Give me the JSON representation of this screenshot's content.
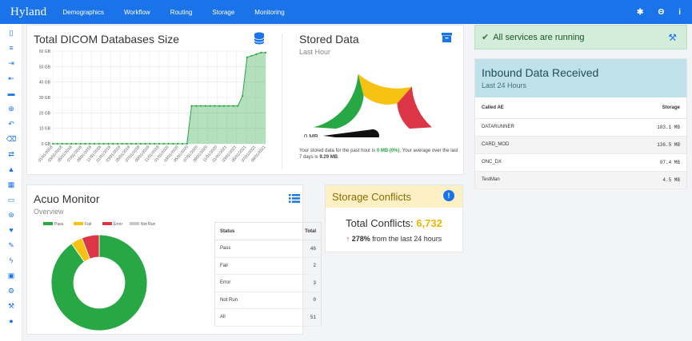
{
  "nav": {
    "brand": "Hyland",
    "links": [
      "Demographics",
      "Workflow",
      "Routing",
      "Storage",
      "Monitoring"
    ],
    "right_icons": [
      "gear-icon",
      "user-circle-icon",
      "info-icon"
    ],
    "right_glyphs": [
      "✱",
      "Θ",
      "i"
    ]
  },
  "sidebar": {
    "icons": [
      "file-icon",
      "database-icon",
      "sign-in-icon",
      "sign-out-icon",
      "archive-icon",
      "globe-icon",
      "undo-icon",
      "trash-icon",
      "exchange-icon",
      "road-icon",
      "map-icon",
      "hdd-icon",
      "life-ring-icon",
      "heartbeat-icon",
      "edit-icon",
      "bolt-icon",
      "lock-icon",
      "cogs-icon",
      "wrench-icon",
      "info-circle-icon"
    ],
    "glyphs": [
      "▯",
      "≡",
      "⇥",
      "⇤",
      "▬",
      "⊕",
      "↶",
      "⌫",
      "⇄",
      "▲",
      "▦",
      "▭",
      "⊛",
      "♥",
      "✎",
      "ϟ",
      "▣",
      "⚙",
      "⚒",
      "●"
    ]
  },
  "dicom": {
    "title": "Total DICOM Databases Size",
    "icon": "database-icon"
  },
  "stored": {
    "title": "Stored Data",
    "subtitle": "Last Hour",
    "icon": "archive-icon",
    "gauge_label": "0 MB",
    "gauge_fraction": 0.0,
    "note_pre": "Your stored data for the past hour is",
    "note_value": "0 MB (0%)",
    "note_mid": ". Your average over the last 7 days is",
    "note_avg": "9.29 MB",
    "note_end": ".",
    "colors": {
      "green": "#28a745",
      "yellow": "#f5c211",
      "red": "#dc3545"
    }
  },
  "services": {
    "text": "All services are running",
    "check": "✔",
    "wrench": "⚒"
  },
  "inbound": {
    "title": "Inbound Data Received",
    "subtitle": "Last 24 Hours",
    "columns": [
      "Called AE",
      "Storage"
    ],
    "rows": [
      [
        "DATARUNNER",
        "183.1 MB"
      ],
      [
        "CARD_MOD",
        "136.5 MB"
      ],
      [
        "ONC_DX",
        "97.4 MB"
      ],
      [
        "TestMan",
        "4.5 MB"
      ]
    ]
  },
  "acuo": {
    "title": "Acuo Monitor",
    "subtitle": "Overview",
    "icon": "list-icon",
    "columns": [
      "Status",
      "Total"
    ],
    "rows": [
      [
        "Pass",
        "46"
      ],
      [
        "Fail",
        "2"
      ],
      [
        "Error",
        "3"
      ],
      [
        "Not Run",
        "0"
      ],
      [
        "All",
        "51"
      ]
    ]
  },
  "conflicts": {
    "title": "Storage Conflicts",
    "total_label": "Total Conflicts:",
    "total_value": "6,732",
    "delta_arrow": "↑",
    "delta_value": "278%",
    "delta_text": "from the last 24 hours"
  },
  "chart_data": [
    {
      "type": "area",
      "title": "Total DICOM Databases Size",
      "y_ticks": [
        "0 GB",
        "10 GB",
        "20 GB",
        "30 GB",
        "40 GB",
        "50 GB",
        "60 GB"
      ],
      "ylim": [
        0,
        60
      ],
      "grid": true,
      "x_ticks": [
        "01/01/2018",
        "03/01/2018",
        "05/01/2018",
        "07/01/2018",
        "09/01/2018",
        "11/01/2018",
        "01/01/2019",
        "03/01/2019",
        "05/01/2019",
        "07/01/2019",
        "09/01/2019",
        "11/01/2019",
        "01/01/2020",
        "03/01/2020",
        "05/01/2020",
        "07/01/2020",
        "09/01/2020",
        "11/01/2020",
        "01/01/2021",
        "03/01/2021",
        "05/01/2021",
        "07/01/2021",
        "09/01/2021"
      ],
      "tick_labels_shown": [
        "01/01/2018",
        "03/01/2018",
        "05/01/2018",
        "07/01/2018",
        "09/01/2018",
        "11/01/2018",
        "01/01/2019",
        "03/01/2019",
        "05/01/2019",
        "07/01/2019",
        "09/01/2019",
        "11/01/2019",
        "01/01/2020",
        "03/01/2020",
        "05/01/2020",
        "07/01/2020",
        "09/01/2020",
        "11/01/2020",
        "01/01/2021",
        "03/01/2021",
        "05/01/2021",
        "07/01/2021",
        "09/01/2021"
      ],
      "series": [
        {
          "values": [
            0,
            0,
            0,
            0,
            0,
            0,
            0,
            0,
            0,
            0,
            0,
            0,
            0,
            0,
            0,
            0,
            0,
            0,
            0,
            0,
            0,
            0,
            0,
            0,
            0,
            0,
            0,
            0,
            0,
            0,
            24.5,
            24.5,
            24.5,
            24.5,
            24.5,
            24.5,
            24.5,
            24.5,
            24.5,
            24.5,
            24.5,
            31,
            56,
            57,
            58,
            59,
            59
          ]
        }
      ],
      "color": "#28a745"
    },
    {
      "type": "pie",
      "legend": [
        "Pass",
        "Fail",
        "Error",
        "Not Run"
      ],
      "legend_position": "top",
      "values": [
        46,
        2,
        3,
        0
      ],
      "colors": [
        "#28a745",
        "#f5c211",
        "#dc3545",
        "#c8c8c8"
      ],
      "donut": true
    }
  ]
}
